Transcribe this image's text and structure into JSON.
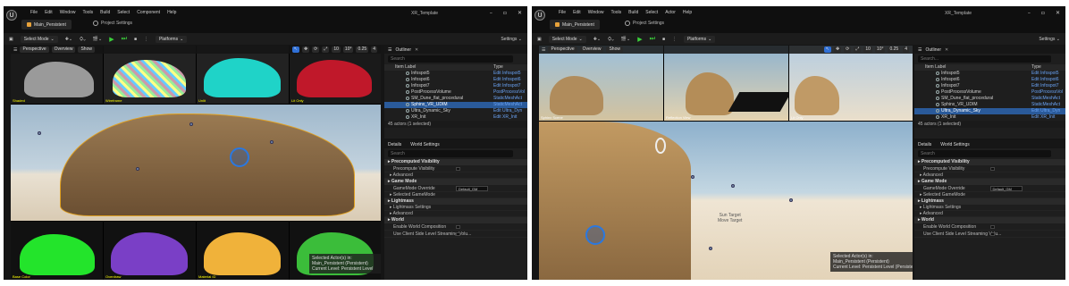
{
  "left": {
    "menu": [
      "File",
      "Edit",
      "Window",
      "Tools",
      "Build",
      "Select",
      "Component",
      "Help"
    ],
    "project_tab": "Main_Persistent",
    "project_settings": "Project Settings",
    "app_title": "XR_Template",
    "toolbar": {
      "select_mode": "Select Mode",
      "platforms": "Platforms",
      "settings": "Settings"
    },
    "viewport": {
      "perspective": "Perspective",
      "overview": "Overview",
      "show": "Show",
      "tools": [
        "10",
        "10°",
        "0.25",
        "4"
      ]
    },
    "tile_labels": [
      "Shaded",
      "Wireframe",
      "Unlit",
      "Lit Only",
      "Base Color",
      "Overdraw",
      "Material ID",
      "Buffer"
    ],
    "overlay": [
      "Selected Actor(s) in:",
      "Main_Persistent (Persistent)",
      "Current Level: Persistent Level"
    ],
    "outliner": {
      "title": "Outliner",
      "search": "Search",
      "col_label": "Item Label",
      "col_type": "Type",
      "rows": [
        {
          "label": "Infospot5",
          "type": "Edit Infospot5"
        },
        {
          "label": "Infospot6",
          "type": "Edit Infospot6"
        },
        {
          "label": "Infospot7",
          "type": "Edit Infospot7"
        },
        {
          "label": "PostProcessVolume",
          "type": "PostProcessVol"
        },
        {
          "label": "SM_Dune_flat_procedural",
          "type": "StaticMeshAct"
        },
        {
          "label": "Sphinx_VR_UDIM",
          "type": "StaticMeshAct"
        },
        {
          "label": "Ultra_Dynamic_Sky",
          "type": "Edit Ultra_Dyn"
        },
        {
          "label": "XR_Init",
          "type": "Edit XR_Init"
        }
      ],
      "selected_index": 5,
      "footer": "45 actors (1 selected)"
    },
    "details": {
      "tab1": "Details",
      "tab2": "World Settings",
      "search": "Search",
      "items": [
        {
          "kind": "cat",
          "text": "Precomputed Visibility"
        },
        {
          "kind": "prop",
          "text": "Precompute Visibility",
          "ctrl": "chk"
        },
        {
          "kind": "sub",
          "text": "Advanced"
        },
        {
          "kind": "cat",
          "text": "Game Mode"
        },
        {
          "kind": "prop",
          "text": "GameMode Override",
          "ctrl": "dd",
          "value": "Default_GM"
        },
        {
          "kind": "sub",
          "text": "Selected GameMode"
        },
        {
          "kind": "cat",
          "text": "Lightmass"
        },
        {
          "kind": "sub",
          "text": "Lightmass Settings"
        },
        {
          "kind": "sub",
          "text": "Advanced"
        },
        {
          "kind": "cat",
          "text": "World"
        },
        {
          "kind": "prop",
          "text": "Enable World Composition",
          "ctrl": "chk"
        },
        {
          "kind": "prop",
          "text": "Use Client Side Level Streaming Volu...",
          "ctrl": "chk"
        }
      ]
    }
  },
  "right": {
    "menu": [
      "File",
      "Edit",
      "Window",
      "Tools",
      "Build",
      "Select",
      "Actor",
      "Help"
    ],
    "project_tab": "Main_Persistent",
    "project_settings": "Project Settings",
    "app_title": "XR_Template",
    "toolbar": {
      "select_mode": "Select Mode",
      "platforms": "Platforms",
      "settings": "Settings"
    },
    "viewport": {
      "perspective": "Perspective",
      "overview": "Overview",
      "show": "Show",
      "tools": [
        "10",
        "10°",
        "0.25",
        "4"
      ]
    },
    "tile_labels": [
      "Sphinx Scene",
      "Reflection View",
      "Lit Only"
    ],
    "center_text": [
      "Sun Target",
      "Move Target"
    ],
    "overlay": [
      "Selected Actor(s) in:",
      "Main_Persistent (Persistent)",
      "Current Level: Persistent Level (Persistent)"
    ],
    "outliner": {
      "title": "Outliner",
      "search": "Search...",
      "col_label": "Item Label",
      "col_type": "Type",
      "rows": [
        {
          "label": "Infospot5",
          "type": "Edit Infospot5"
        },
        {
          "label": "Infospot6",
          "type": "Edit Infospot6"
        },
        {
          "label": "Infospot7",
          "type": "Edit Infospot7"
        },
        {
          "label": "PostProcessVolume",
          "type": "PostProcessVol"
        },
        {
          "label": "SM_Dune_flat_procedural",
          "type": "StaticMeshAct"
        },
        {
          "label": "Sphinx_VR_UDIM",
          "type": "StaticMeshAct"
        },
        {
          "label": "Ultra_Dynamic_Sky",
          "type": "Edit Ultra_Dyn"
        },
        {
          "label": "XR_Init",
          "type": "Edit XR_Init"
        }
      ],
      "selected_index": 6,
      "footer": "45 actors (1 selected)"
    },
    "details": {
      "tab1": "Details",
      "tab2": "World Settings",
      "search": "Search",
      "items": [
        {
          "kind": "cat",
          "text": "Precomputed Visibility"
        },
        {
          "kind": "prop",
          "text": "Precompute Visibility",
          "ctrl": "chk"
        },
        {
          "kind": "sub",
          "text": "Advanced"
        },
        {
          "kind": "cat",
          "text": "Game Mode"
        },
        {
          "kind": "prop",
          "text": "GameMode Override",
          "ctrl": "dd",
          "value": "Default_GM"
        },
        {
          "kind": "sub",
          "text": "Selected GameMode"
        },
        {
          "kind": "cat",
          "text": "Lightmass"
        },
        {
          "kind": "sub",
          "text": "Lightmass Settings"
        },
        {
          "kind": "sub",
          "text": "Advanced"
        },
        {
          "kind": "cat",
          "text": "World"
        },
        {
          "kind": "prop",
          "text": "Enable World Composition",
          "ctrl": "chk"
        },
        {
          "kind": "prop",
          "text": "Use Client Side Level Streaming Volu...",
          "ctrl": "chk"
        }
      ]
    }
  },
  "colors": {
    "accent": "#2f6fd6",
    "play": "#3bd13b",
    "selection": "#2a5a9a",
    "link": "#6aa3f5"
  }
}
